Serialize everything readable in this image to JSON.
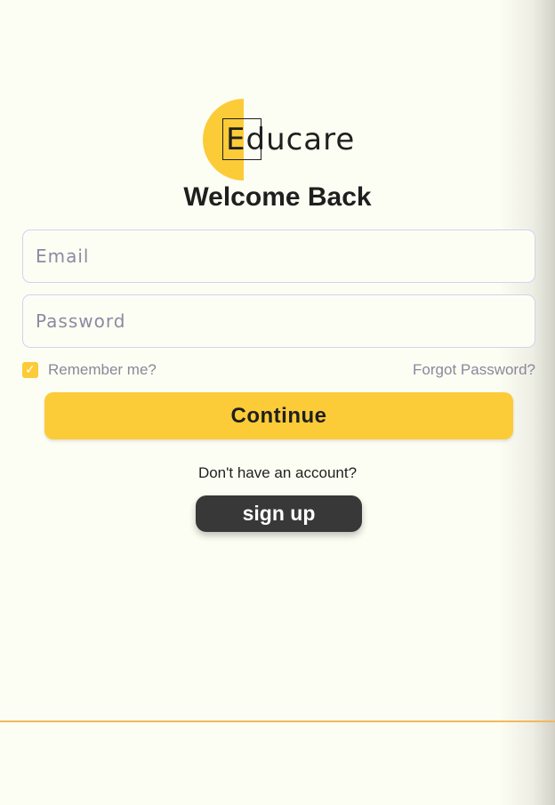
{
  "brand": {
    "name": "Educare",
    "accent_color": "#fccb38"
  },
  "login": {
    "title": "Welcome Back",
    "email_placeholder": "Email",
    "email_value": "",
    "password_placeholder": "Password",
    "password_value": "",
    "remember_label": "Remember me?",
    "remember_checked": true,
    "forgot_label": "Forgot Password?",
    "continue_label": "Continue"
  },
  "signup": {
    "prompt": "Don't have an account?",
    "button_label": "sign up"
  },
  "icons": {
    "checkbox": "check-icon"
  }
}
